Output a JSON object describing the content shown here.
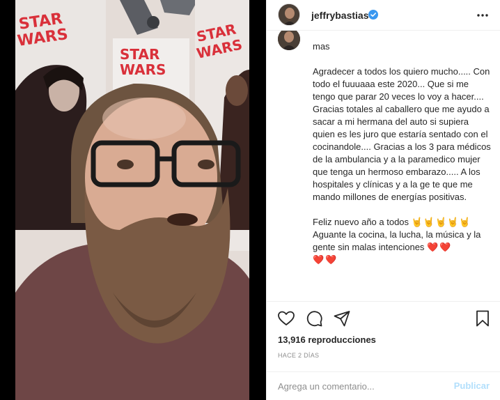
{
  "post": {
    "username": "jeffrybastias",
    "verified_icon": "verified-badge-icon",
    "more_icon": "more-options-icon"
  },
  "media": {
    "poster_text": "STAR WARS"
  },
  "caption": {
    "line0": "mas",
    "paragraph1": "Agradecer a todos los quiero mucho..... Con todo el fuuuaaa este 2020... Que si me tengo que parar 20 veces lo voy a hacer.... Gracias totales al caballero que me ayudo a sacar a mi hermana del auto si supiera quien es les juro que estaría sentado con el cocinandole.... Gracias a los 3 para médicos de la ambulancia y a la paramedico mujer que tenga un hermoso embarazo..... A los hospitales y clínicas y a la ge te que me mando millones de energías positivas.",
    "paragraph2_a": "Feliz nuevo año a todos ",
    "paragraph2_emoji": "🤘🤘🤘🤘🤘",
    "paragraph2_b": "Aguante la cocina, la lucha, la música y la gente sin malas intenciones ",
    "hearts_inline": "❤️❤️",
    "hearts_line": "❤️❤️"
  },
  "actions": {
    "like_icon": "heart-icon",
    "comment_icon": "comment-icon",
    "share_icon": "share-icon",
    "save_icon": "bookmark-icon"
  },
  "stats": {
    "views": "13,916 reproducciones",
    "timestamp": "HACE 2 DÍAS"
  },
  "comment_form": {
    "placeholder": "Agrega un comentario...",
    "publish_label": "Publicar"
  },
  "colors": {
    "accent_blue": "#0095f6",
    "publish_disabled": "#b2dffc",
    "heart_red": "#ed4956",
    "muted_text": "#8e8e8e"
  }
}
